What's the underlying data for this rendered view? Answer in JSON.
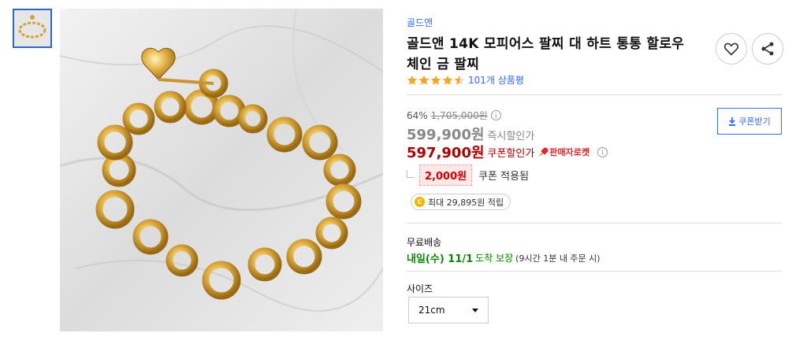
{
  "brand": "골드앤",
  "title": "골드앤 14K 모피어스 팔찌 대 하트 통통 할로우 체인 금 팔찌",
  "rating": {
    "stars": 4.5,
    "review_text": "101개 상품평"
  },
  "pricing": {
    "discount_rate": "64%",
    "original_price": "1,705,000원",
    "instant_price": "599,900원",
    "instant_label": "즉시할인가",
    "coupon_price": "597,900원",
    "coupon_label": "쿠폰할인가",
    "seller_rocket": "판매자로켓",
    "coupon_amount": "2,000원",
    "coupon_applied": "쿠폰 적용됨",
    "reward": "최대 29,895원 적립",
    "info_glyph": "i",
    "coin_glyph": "C"
  },
  "coupon_button": {
    "label": "쿠폰받기"
  },
  "shipping": {
    "label": "무료배송",
    "date": "내일(수) 11/1",
    "guarantee": "도착 보장",
    "note": "(9시간 1분 내 주문 시)"
  },
  "options": {
    "size_label": "사이즈",
    "size_value": "21cm"
  },
  "colors": {
    "accent": "#346aff",
    "price_red": "#ae0000",
    "star": "#f5a623",
    "shipping_green": "#0a8a00"
  },
  "icons": [
    "heart-icon",
    "share-icon",
    "download-icon",
    "rocket-icon",
    "info-icon",
    "coin-icon",
    "star-icon",
    "chevron-down-icon"
  ]
}
